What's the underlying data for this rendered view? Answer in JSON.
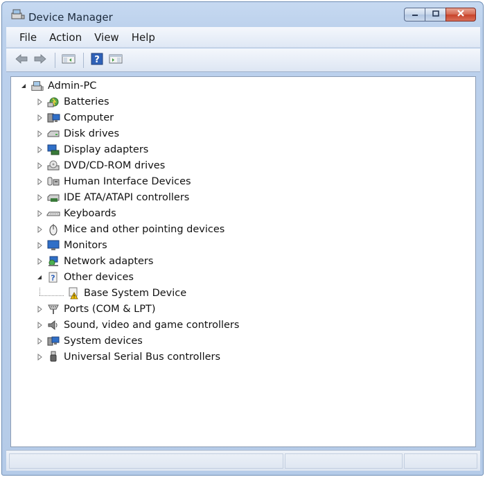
{
  "window": {
    "title": "Device Manager",
    "title_icon": "device-manager-icon",
    "controls": [
      "minimize-icon",
      "maximize-icon",
      "close-icon"
    ]
  },
  "menu": {
    "items": [
      "File",
      "Action",
      "View",
      "Help"
    ]
  },
  "toolbar": {
    "buttons": [
      "back-arrow-icon",
      "forward-arrow-icon",
      "show-hide-console-tree-icon",
      "help-icon",
      "properties-icon"
    ]
  },
  "tree": {
    "root": {
      "label": "Admin-PC",
      "icon": "computer-root-icon",
      "expanded": true
    },
    "categories": [
      {
        "label": "Batteries",
        "icon": "battery-icon",
        "expanded": false
      },
      {
        "label": "Computer",
        "icon": "computer-icon",
        "expanded": false
      },
      {
        "label": "Disk drives",
        "icon": "disk-drive-icon",
        "expanded": false
      },
      {
        "label": "Display adapters",
        "icon": "display-adapter-icon",
        "expanded": false
      },
      {
        "label": "DVD/CD-ROM drives",
        "icon": "dvd-drive-icon",
        "expanded": false
      },
      {
        "label": "Human Interface Devices",
        "icon": "hid-icon",
        "expanded": false
      },
      {
        "label": "IDE ATA/ATAPI controllers",
        "icon": "ide-controller-icon",
        "expanded": false
      },
      {
        "label": "Keyboards",
        "icon": "keyboard-icon",
        "expanded": false
      },
      {
        "label": "Mice and other pointing devices",
        "icon": "mouse-icon",
        "expanded": false
      },
      {
        "label": "Monitors",
        "icon": "monitor-icon",
        "expanded": false
      },
      {
        "label": "Network adapters",
        "icon": "network-adapter-icon",
        "expanded": false
      },
      {
        "label": "Other devices",
        "icon": "unknown-device-icon",
        "expanded": true,
        "children": [
          {
            "label": "Base System Device",
            "icon": "warning-device-icon"
          }
        ]
      },
      {
        "label": "Ports (COM & LPT)",
        "icon": "port-icon",
        "expanded": false
      },
      {
        "label": "Sound, video and game controllers",
        "icon": "sound-icon",
        "expanded": false
      },
      {
        "label": "System devices",
        "icon": "system-device-icon",
        "expanded": false
      },
      {
        "label": "Universal Serial Bus controllers",
        "icon": "usb-icon",
        "expanded": false
      }
    ]
  },
  "colors": {
    "window_frame": "#b5cbe8",
    "close_button": "#c7432a",
    "tree_background": "#ffffff"
  }
}
